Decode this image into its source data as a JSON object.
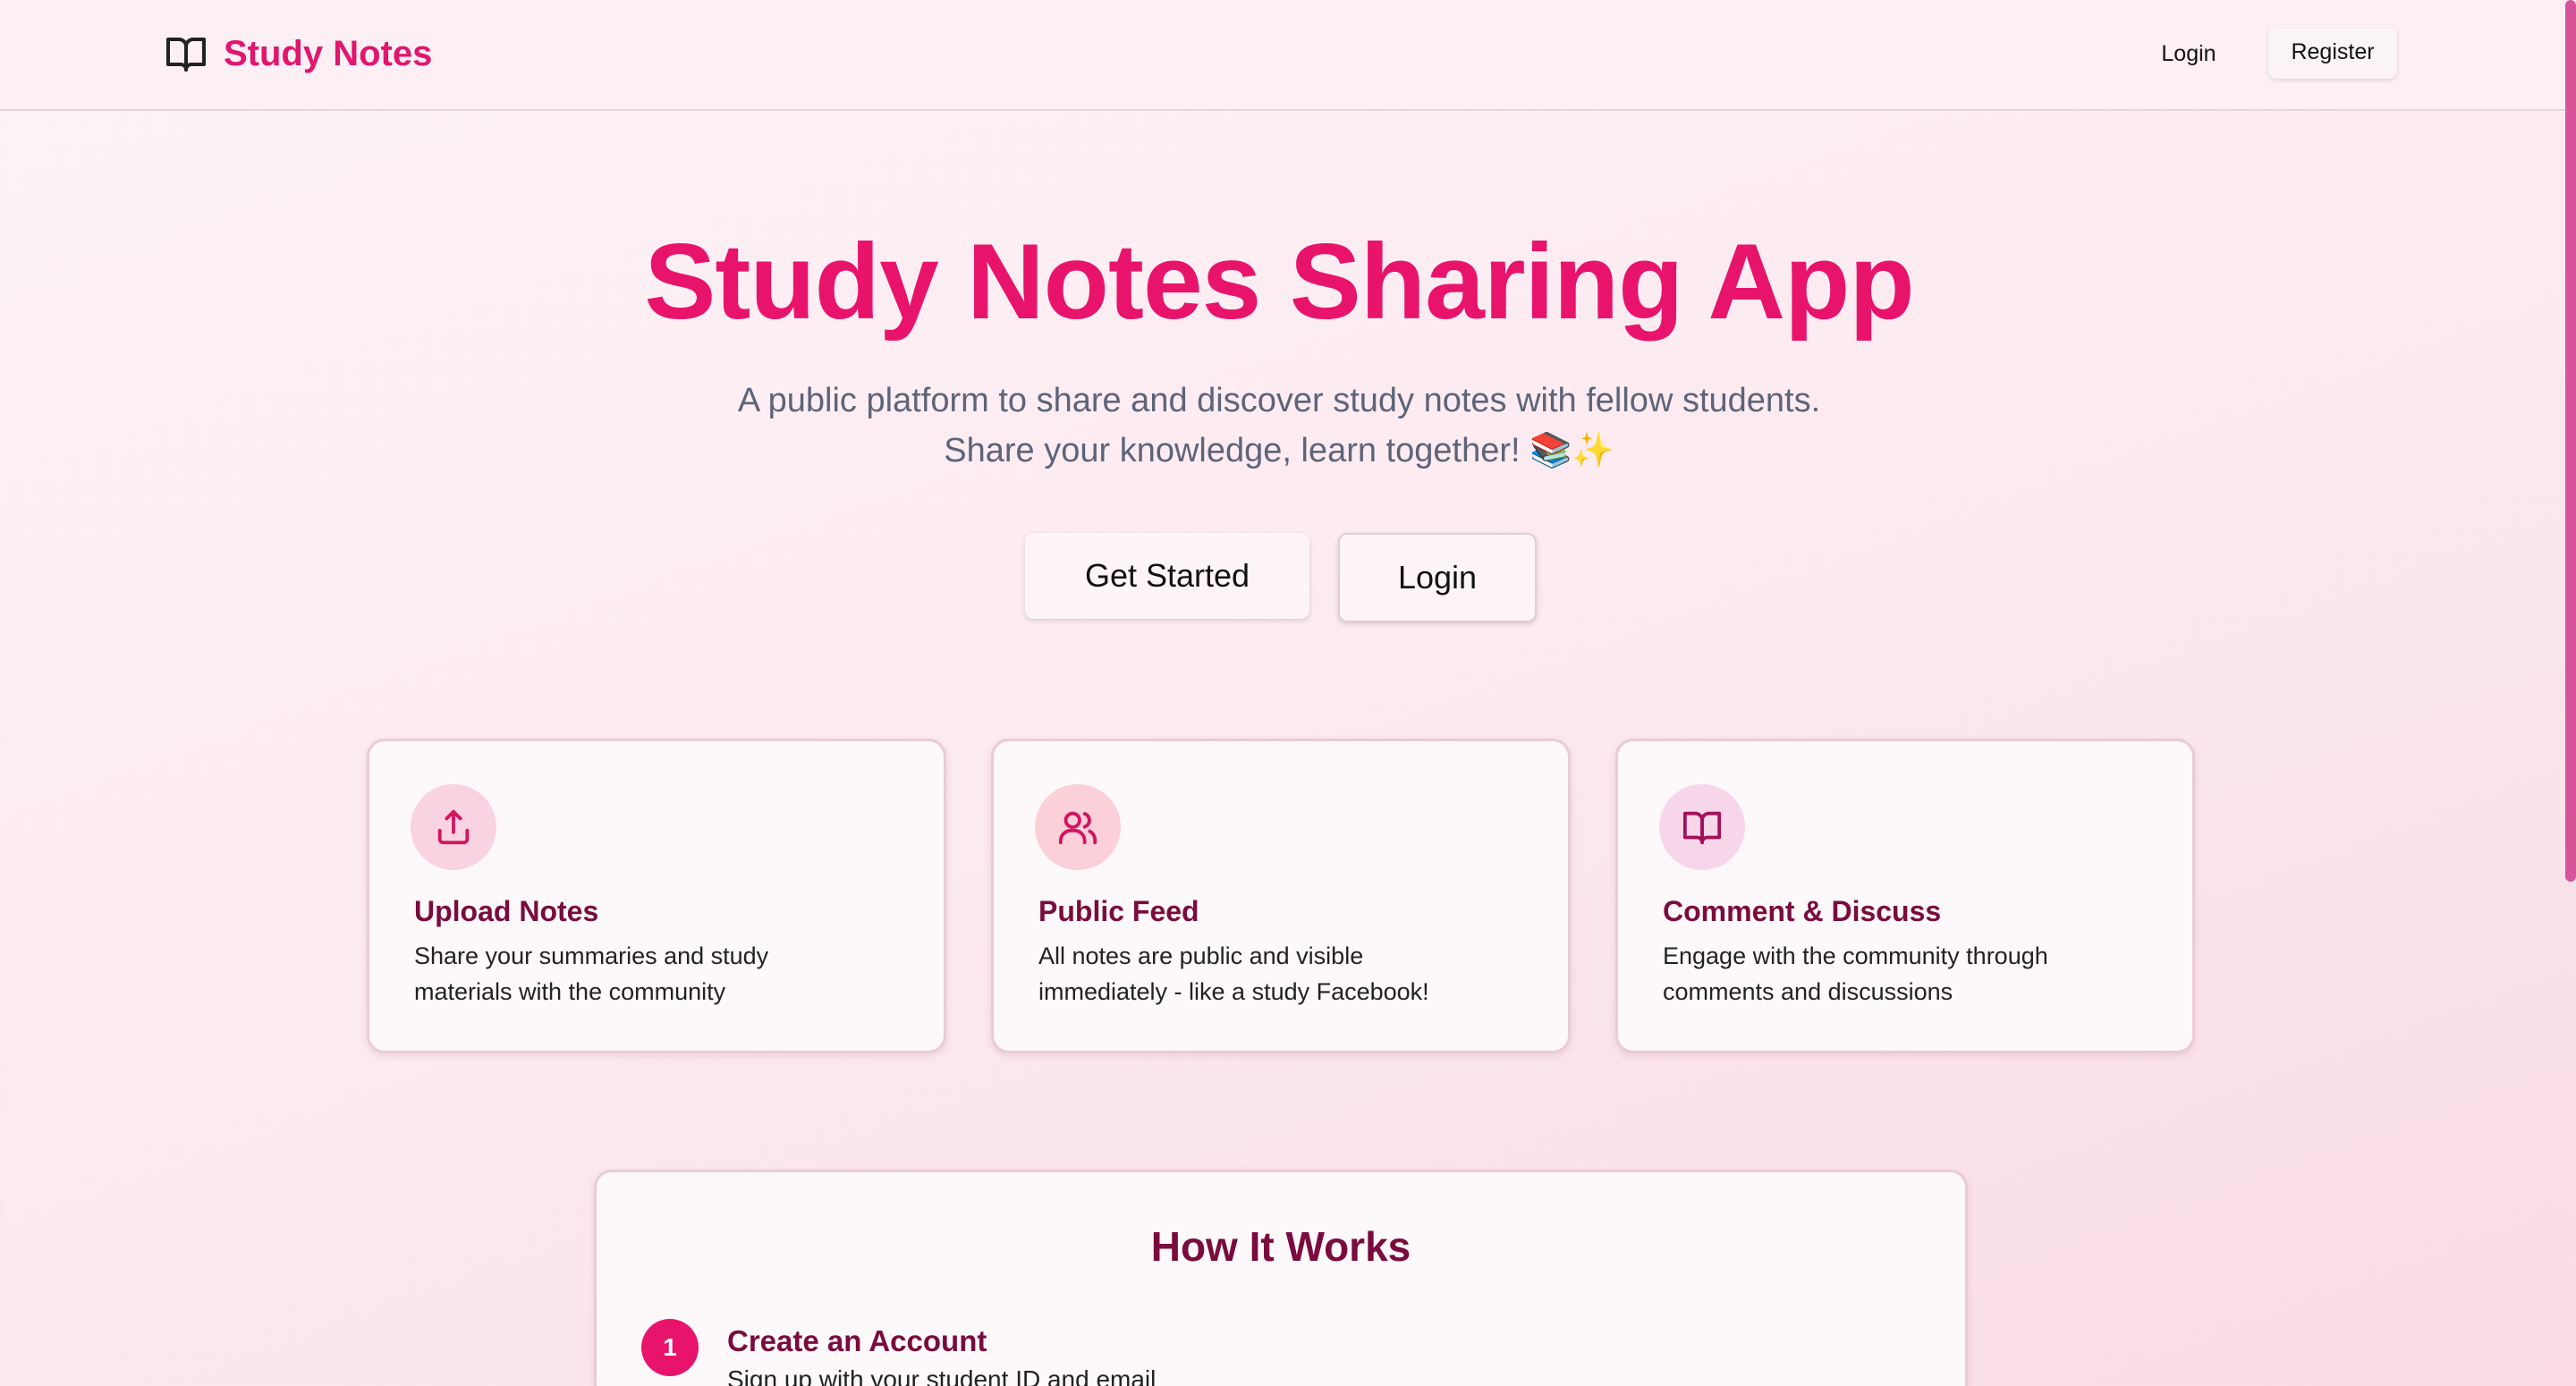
{
  "header": {
    "brand": "Study Notes",
    "login_label": "Login",
    "register_label": "Register"
  },
  "hero": {
    "title": "Study Notes Sharing App",
    "subtitle_line1": "A public platform to share and discover study notes with fellow students.",
    "subtitle_line2": "Share your knowledge, learn together! 📚✨",
    "primary_button": "Get Started",
    "secondary_button": "Login"
  },
  "features": [
    {
      "icon": "upload-icon",
      "title": "Upload Notes",
      "desc_line1": "Share your summaries and study",
      "desc_line2": "materials with the community"
    },
    {
      "icon": "users-icon",
      "title": "Public Feed",
      "desc_line1": "All notes are public and visible",
      "desc_line2": "immediately - like a study Facebook!"
    },
    {
      "icon": "book-open-icon",
      "title": "Comment & Discuss",
      "desc_line1": "Engage with the community through",
      "desc_line2": "comments and discussions"
    }
  ],
  "how_it_works": {
    "title": "How It Works",
    "steps": [
      {
        "number": "1",
        "title": "Create an Account",
        "desc": "Sign up with your student ID and email"
      }
    ]
  },
  "colors": {
    "accent": "#e8146c",
    "heading_dark": "#7a0b3d",
    "icon_bg": "#fad3e3"
  }
}
